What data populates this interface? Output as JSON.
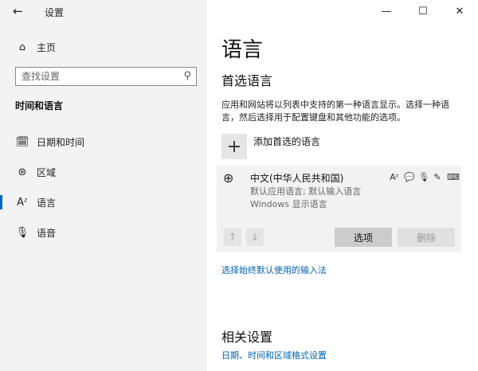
{
  "app": {
    "title": "设置",
    "controls": {
      "minimize": "—",
      "maximize": "☐",
      "close": "✕"
    }
  },
  "sidebar": {
    "home_label": "主页",
    "search": {
      "placeholder": "查找设置"
    },
    "section_heading": "时间和语言",
    "items": [
      {
        "label": "日期和时间",
        "icon": "calendar-clock-icon"
      },
      {
        "label": "区域",
        "icon": "globe-icon"
      },
      {
        "label": "语言",
        "icon": "language-icon",
        "active": true
      },
      {
        "label": "语音",
        "icon": "microphone-icon"
      }
    ]
  },
  "main": {
    "title": "语言",
    "preferred_heading": "首选语言",
    "description": "应用和网站将以列表中支持的第一种语言显示。选择一种语言，然后选择用于配置键盘和其他功能的选项。",
    "add_language_label": "添加首选的语言",
    "language_entry": {
      "name": "中文(中华人民共和国)",
      "line1": "默认应用语言; 默认输入语言",
      "line2": "Windows 显示语言"
    },
    "options_button": "选项",
    "remove_button": "删除",
    "input_method_link": "选择始终默认使用的输入法",
    "related_heading": "相关设置",
    "related_link": "日期、时间和区域格式设置"
  },
  "colors": {
    "accent": "#0067c0",
    "link": "#0063b1",
    "sidebar_bg": "#f3f3f3",
    "panel_bg": "#f2f2f2"
  }
}
